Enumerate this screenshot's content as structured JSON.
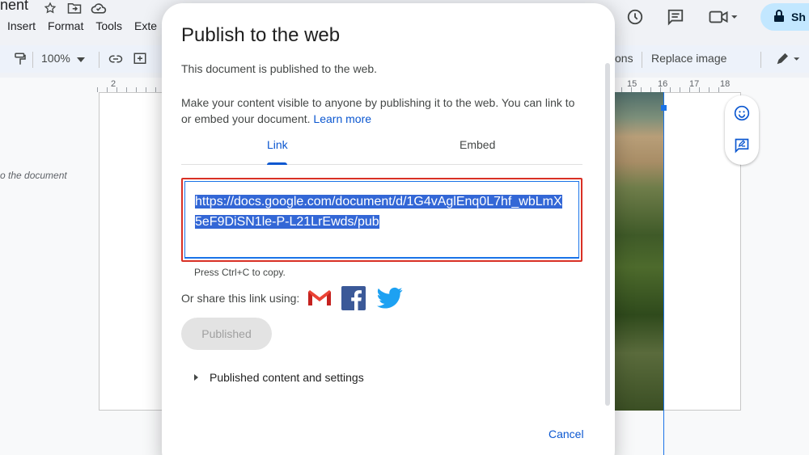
{
  "app": {
    "doc_title_fragment": "nent",
    "menu": [
      "Insert",
      "Format",
      "Tools",
      "Exte"
    ],
    "share_label": "Sh",
    "toolbar": {
      "zoom": "100%",
      "options_fragment": "ons",
      "replace_image": "Replace image"
    },
    "ruler_numbers": [
      "2",
      "15",
      "16",
      "17",
      "18"
    ],
    "page_note": "o the document"
  },
  "dialog": {
    "title": "Publish to the web",
    "status": "This document is published to the web.",
    "description": "Make your content visible to anyone by publishing it to the web. You can link to or embed your document.",
    "learn_more": "Learn more",
    "tabs": {
      "link": "Link",
      "embed": "Embed",
      "active": "link"
    },
    "url_line1": "https://docs.google.com/document/d/1G4vAglEnq0L7hf_wbLmX",
    "url_line2": "5eF9DiSN1le-P-L21LrEwds/pub",
    "copy_hint": "Press Ctrl+C to copy.",
    "share_label": "Or share this link using:",
    "share_icons": [
      "gmail-icon",
      "facebook-icon",
      "twitter-icon"
    ],
    "published_button": "Published",
    "settings_toggle": "Published content and settings",
    "cancel": "Cancel"
  },
  "colors": {
    "accent": "#0b57d0",
    "selection": "#3367d6",
    "highlight_border": "#d93025",
    "share_button": "#c2e7ff"
  }
}
